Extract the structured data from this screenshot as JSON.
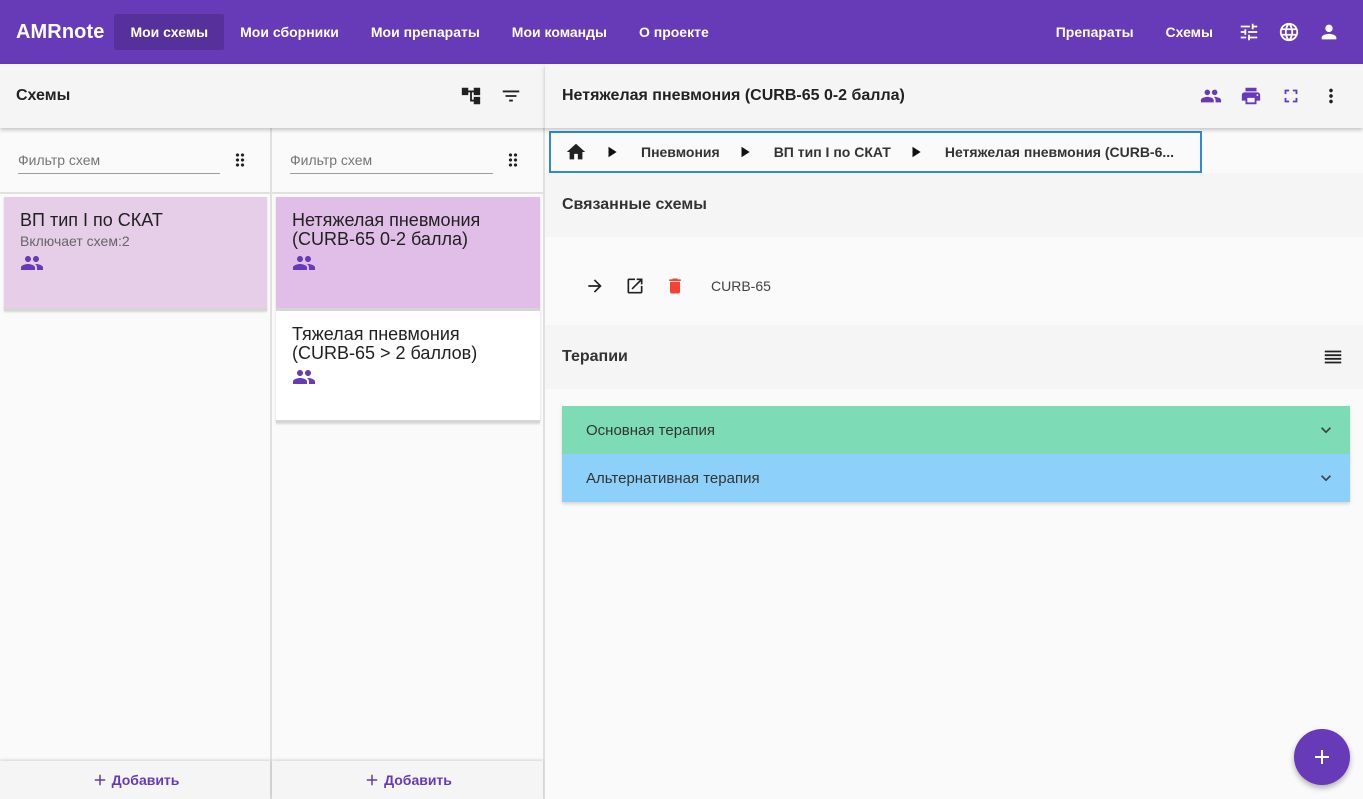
{
  "app": {
    "brand": "AMRnote",
    "nav": [
      "Мои схемы",
      "Мои сборники",
      "Мои препараты",
      "Мои команды",
      "О проекте"
    ],
    "right_nav": [
      "Препараты",
      "Схемы"
    ],
    "accent": "#673ab7"
  },
  "left": {
    "title": "Схемы",
    "col1": {
      "filter_placeholder": "Фильтр схем",
      "items": [
        {
          "title": "ВП тип I по СКАТ",
          "subtitle": "Включает схем:2"
        }
      ],
      "add_label": "Добавить"
    },
    "col2": {
      "filter_placeholder": "Фильтр схем",
      "items": [
        {
          "title": "Нетяжелая пневмония (CURB-65 0-2 балла)"
        },
        {
          "title": "Тяжелая пневмония (CURB-65 > 2 баллов)"
        }
      ],
      "add_label": "Добавить"
    }
  },
  "right": {
    "title": "Нетяжелая пневмония (CURB-65 0-2 балла)",
    "breadcrumb": [
      "Пневмония",
      "ВП тип I по СКАТ",
      "Нетяжелая пневмония (CURB-6..."
    ],
    "linked_title": "Связанные схемы",
    "linked_item": "CURB-65",
    "therapies_title": "Терапии",
    "therapies": [
      {
        "label": "Основная терапия",
        "color": "#7ddbb6"
      },
      {
        "label": "Альтернативная терапия",
        "color": "#8dd1fb"
      }
    ]
  }
}
